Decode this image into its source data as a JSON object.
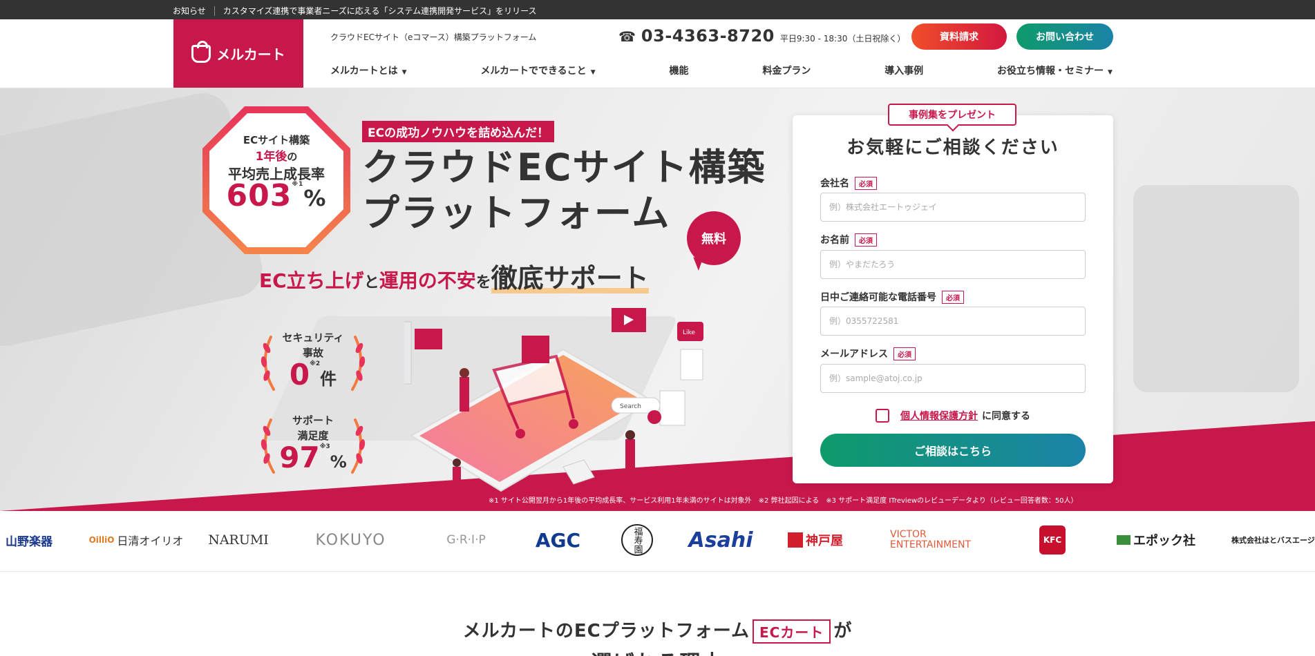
{
  "announcement": {
    "label": "お知らせ",
    "text": "カスタマイズ連携で事業者ニーズに応える「システム連携開発サービス」をリリース"
  },
  "header": {
    "logo_text": "メルカート",
    "tagline": "クラウドECサイト（eコマース）構築プラットフォーム",
    "phone": "03-4363-8720",
    "hours": "平日9:30 - 18:30（土日祝除く）",
    "btn_document": "資料請求",
    "btn_contact": "お問い合わせ"
  },
  "nav": {
    "items": [
      {
        "label": "メルカートとは",
        "has_dropdown": true
      },
      {
        "label": "メルカートでできること",
        "has_dropdown": true
      },
      {
        "label": "機能",
        "has_dropdown": false
      },
      {
        "label": "料金プラン",
        "has_dropdown": false
      },
      {
        "label": "導入事例",
        "has_dropdown": false
      },
      {
        "label": "お役立ち情報・セミナー",
        "has_dropdown": true
      }
    ],
    "dropdown_glyph": "▼"
  },
  "hero": {
    "badge": {
      "line1": "ECサイト構築",
      "line2_red": "1年後",
      "line2_rest": "の",
      "line3": "平均売上成長率",
      "value": "603",
      "unit": "%",
      "note": "※1"
    },
    "ribbon": "ECの成功ノウハウを詰め込んだ！",
    "title_line1": "クラウドECサイト構築",
    "title_line2": "プラットフォーム",
    "free_badge": "無料",
    "subtitle": {
      "part1": "EC立ち上げ",
      "part2": "と",
      "part3": "運用の不安",
      "part4": "を",
      "part5": "徹底サポート"
    },
    "stat_security": {
      "label1": "セキュリティ",
      "label2": "事故",
      "value": "0",
      "unit": "件",
      "note": "※2"
    },
    "stat_support": {
      "label1": "サポート",
      "label2": "満足度",
      "value": "97",
      "unit": "%",
      "note": "※3"
    },
    "illus_search": "Search",
    "illus_like": "Like",
    "notes": "※1 サイト公開翌月から1年後の平均成長率、サービス利用1年未満のサイトは対象外　※2 弊社起因による　※3 サポート満足度 ITreviewのレビューデータより（レビュー回答者数：50人）"
  },
  "form": {
    "tag": "事例集をプレゼント",
    "title": "お気軽にご相談ください",
    "required": "必須",
    "fields": [
      {
        "label": "会社名",
        "placeholder": "例）株式会社エートゥジェイ"
      },
      {
        "label": "お名前",
        "placeholder": "例）やまだたろう"
      },
      {
        "label": "日中ご連絡可能な電話番号",
        "placeholder": "例）0355722581"
      },
      {
        "label": "メールアドレス",
        "placeholder": "例）sample@atoj.co.jp"
      }
    ],
    "agree_link": "個人情報保護方針",
    "agree_text": "に同意する",
    "submit": "ご相談はこちら"
  },
  "logos": [
    {
      "name": "山野楽器",
      "color": "#1a3a8f"
    },
    {
      "name": "日清オイリオ",
      "color": "#333333"
    },
    {
      "name": "NARUMI",
      "color": "#333333"
    },
    {
      "name": "KOKUYO",
      "color": "#888888"
    },
    {
      "name": "G·R·I·P",
      "color": "#999999"
    },
    {
      "name": "AGC",
      "color": "#0f3a8f"
    },
    {
      "name": "福寿園",
      "color": "#222222"
    },
    {
      "name": "Asahi",
      "color": "#1c3f9c"
    },
    {
      "name": "神戸屋",
      "color": "#d31f2b"
    },
    {
      "name": "VICTOR ENTERTAINMENT",
      "color": "#e05a3a"
    },
    {
      "name": "KFC",
      "color": "#c8102e"
    },
    {
      "name": "エポック社",
      "color": "#222222"
    },
    {
      "name": "株式会社はとバスエージェンシー",
      "color": "#222222"
    }
  ],
  "section": {
    "heading_pre": "メルカートのECプラットフォーム",
    "heading_box": "ECカート",
    "heading_post": "が",
    "heading_line2": "選ばれる理由"
  },
  "colors": {
    "brand": "#c8174b",
    "accent_orange": "#f04e2a",
    "accent_green": "#0f9a6b",
    "dark": "#333333"
  }
}
